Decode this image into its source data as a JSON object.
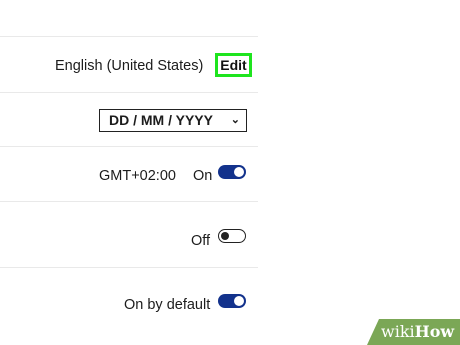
{
  "settings": {
    "language": {
      "value": "English (United States)",
      "edit_label": "Edit"
    },
    "date_format": {
      "selected": "DD / MM / YYYY"
    },
    "timezone": {
      "value": "GMT+02:00",
      "state_label": "On",
      "enabled": true
    },
    "option_off": {
      "state_label": "Off",
      "enabled": false
    },
    "option_default": {
      "state_label": "On by default",
      "enabled": true
    }
  },
  "icons": {
    "dropdown": "chevron-down-icon"
  },
  "colors": {
    "toggle_on": "#13328c",
    "highlight": "#1ee41e",
    "watermark_bg": "#7ba756"
  },
  "watermark": {
    "prefix": "wiki",
    "suffix": "How"
  }
}
